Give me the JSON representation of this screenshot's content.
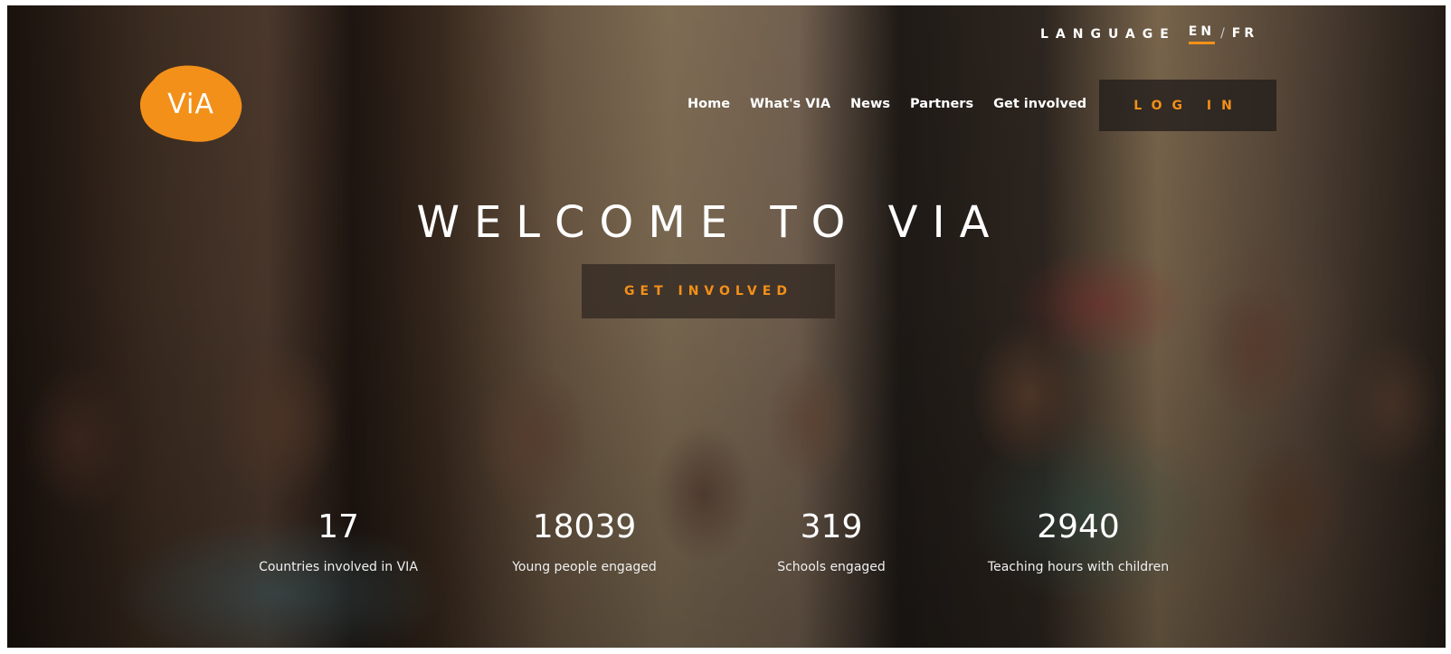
{
  "brand": {
    "logo_text": "ViA",
    "color": "#f39019"
  },
  "language": {
    "label": "LANGUAGE",
    "options": [
      "EN",
      "FR"
    ],
    "separator": "/",
    "selected": "EN"
  },
  "nav": {
    "items": [
      "Home",
      "What's VIA",
      "News",
      "Partners",
      "Get involved"
    ]
  },
  "login_label": "LOG IN",
  "hero": {
    "headline": "WELCOME TO VIA",
    "cta_label": "GET INVOLVED"
  },
  "stats": [
    {
      "value": "17",
      "caption": "Countries involved in VIA"
    },
    {
      "value": "18039",
      "caption": "Young people engaged"
    },
    {
      "value": "319",
      "caption": "Schools engaged"
    },
    {
      "value": "2940",
      "caption": "Teaching hours with children"
    }
  ]
}
